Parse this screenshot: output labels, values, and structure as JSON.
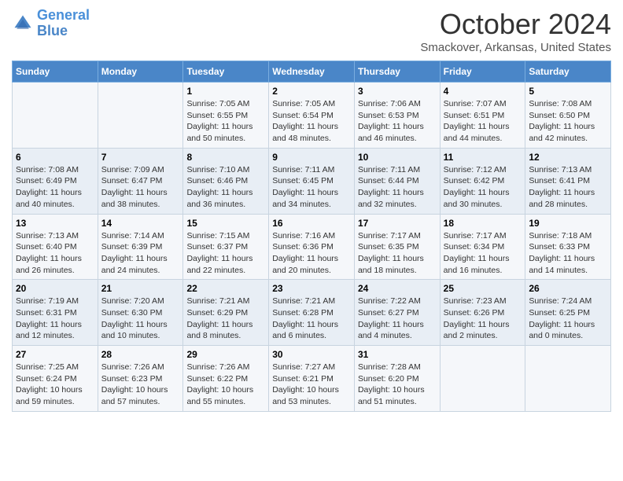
{
  "header": {
    "logo_line1": "General",
    "logo_line2": "Blue",
    "month": "October 2024",
    "location": "Smackover, Arkansas, United States"
  },
  "weekdays": [
    "Sunday",
    "Monday",
    "Tuesday",
    "Wednesday",
    "Thursday",
    "Friday",
    "Saturday"
  ],
  "weeks": [
    [
      {
        "day": "",
        "sunrise": "",
        "sunset": "",
        "daylight": ""
      },
      {
        "day": "",
        "sunrise": "",
        "sunset": "",
        "daylight": ""
      },
      {
        "day": "1",
        "sunrise": "Sunrise: 7:05 AM",
        "sunset": "Sunset: 6:55 PM",
        "daylight": "Daylight: 11 hours and 50 minutes."
      },
      {
        "day": "2",
        "sunrise": "Sunrise: 7:05 AM",
        "sunset": "Sunset: 6:54 PM",
        "daylight": "Daylight: 11 hours and 48 minutes."
      },
      {
        "day": "3",
        "sunrise": "Sunrise: 7:06 AM",
        "sunset": "Sunset: 6:53 PM",
        "daylight": "Daylight: 11 hours and 46 minutes."
      },
      {
        "day": "4",
        "sunrise": "Sunrise: 7:07 AM",
        "sunset": "Sunset: 6:51 PM",
        "daylight": "Daylight: 11 hours and 44 minutes."
      },
      {
        "day": "5",
        "sunrise": "Sunrise: 7:08 AM",
        "sunset": "Sunset: 6:50 PM",
        "daylight": "Daylight: 11 hours and 42 minutes."
      }
    ],
    [
      {
        "day": "6",
        "sunrise": "Sunrise: 7:08 AM",
        "sunset": "Sunset: 6:49 PM",
        "daylight": "Daylight: 11 hours and 40 minutes."
      },
      {
        "day": "7",
        "sunrise": "Sunrise: 7:09 AM",
        "sunset": "Sunset: 6:47 PM",
        "daylight": "Daylight: 11 hours and 38 minutes."
      },
      {
        "day": "8",
        "sunrise": "Sunrise: 7:10 AM",
        "sunset": "Sunset: 6:46 PM",
        "daylight": "Daylight: 11 hours and 36 minutes."
      },
      {
        "day": "9",
        "sunrise": "Sunrise: 7:11 AM",
        "sunset": "Sunset: 6:45 PM",
        "daylight": "Daylight: 11 hours and 34 minutes."
      },
      {
        "day": "10",
        "sunrise": "Sunrise: 7:11 AM",
        "sunset": "Sunset: 6:44 PM",
        "daylight": "Daylight: 11 hours and 32 minutes."
      },
      {
        "day": "11",
        "sunrise": "Sunrise: 7:12 AM",
        "sunset": "Sunset: 6:42 PM",
        "daylight": "Daylight: 11 hours and 30 minutes."
      },
      {
        "day": "12",
        "sunrise": "Sunrise: 7:13 AM",
        "sunset": "Sunset: 6:41 PM",
        "daylight": "Daylight: 11 hours and 28 minutes."
      }
    ],
    [
      {
        "day": "13",
        "sunrise": "Sunrise: 7:13 AM",
        "sunset": "Sunset: 6:40 PM",
        "daylight": "Daylight: 11 hours and 26 minutes."
      },
      {
        "day": "14",
        "sunrise": "Sunrise: 7:14 AM",
        "sunset": "Sunset: 6:39 PM",
        "daylight": "Daylight: 11 hours and 24 minutes."
      },
      {
        "day": "15",
        "sunrise": "Sunrise: 7:15 AM",
        "sunset": "Sunset: 6:37 PM",
        "daylight": "Daylight: 11 hours and 22 minutes."
      },
      {
        "day": "16",
        "sunrise": "Sunrise: 7:16 AM",
        "sunset": "Sunset: 6:36 PM",
        "daylight": "Daylight: 11 hours and 20 minutes."
      },
      {
        "day": "17",
        "sunrise": "Sunrise: 7:17 AM",
        "sunset": "Sunset: 6:35 PM",
        "daylight": "Daylight: 11 hours and 18 minutes."
      },
      {
        "day": "18",
        "sunrise": "Sunrise: 7:17 AM",
        "sunset": "Sunset: 6:34 PM",
        "daylight": "Daylight: 11 hours and 16 minutes."
      },
      {
        "day": "19",
        "sunrise": "Sunrise: 7:18 AM",
        "sunset": "Sunset: 6:33 PM",
        "daylight": "Daylight: 11 hours and 14 minutes."
      }
    ],
    [
      {
        "day": "20",
        "sunrise": "Sunrise: 7:19 AM",
        "sunset": "Sunset: 6:31 PM",
        "daylight": "Daylight: 11 hours and 12 minutes."
      },
      {
        "day": "21",
        "sunrise": "Sunrise: 7:20 AM",
        "sunset": "Sunset: 6:30 PM",
        "daylight": "Daylight: 11 hours and 10 minutes."
      },
      {
        "day": "22",
        "sunrise": "Sunrise: 7:21 AM",
        "sunset": "Sunset: 6:29 PM",
        "daylight": "Daylight: 11 hours and 8 minutes."
      },
      {
        "day": "23",
        "sunrise": "Sunrise: 7:21 AM",
        "sunset": "Sunset: 6:28 PM",
        "daylight": "Daylight: 11 hours and 6 minutes."
      },
      {
        "day": "24",
        "sunrise": "Sunrise: 7:22 AM",
        "sunset": "Sunset: 6:27 PM",
        "daylight": "Daylight: 11 hours and 4 minutes."
      },
      {
        "day": "25",
        "sunrise": "Sunrise: 7:23 AM",
        "sunset": "Sunset: 6:26 PM",
        "daylight": "Daylight: 11 hours and 2 minutes."
      },
      {
        "day": "26",
        "sunrise": "Sunrise: 7:24 AM",
        "sunset": "Sunset: 6:25 PM",
        "daylight": "Daylight: 11 hours and 0 minutes."
      }
    ],
    [
      {
        "day": "27",
        "sunrise": "Sunrise: 7:25 AM",
        "sunset": "Sunset: 6:24 PM",
        "daylight": "Daylight: 10 hours and 59 minutes."
      },
      {
        "day": "28",
        "sunrise": "Sunrise: 7:26 AM",
        "sunset": "Sunset: 6:23 PM",
        "daylight": "Daylight: 10 hours and 57 minutes."
      },
      {
        "day": "29",
        "sunrise": "Sunrise: 7:26 AM",
        "sunset": "Sunset: 6:22 PM",
        "daylight": "Daylight: 10 hours and 55 minutes."
      },
      {
        "day": "30",
        "sunrise": "Sunrise: 7:27 AM",
        "sunset": "Sunset: 6:21 PM",
        "daylight": "Daylight: 10 hours and 53 minutes."
      },
      {
        "day": "31",
        "sunrise": "Sunrise: 7:28 AM",
        "sunset": "Sunset: 6:20 PM",
        "daylight": "Daylight: 10 hours and 51 minutes."
      },
      {
        "day": "",
        "sunrise": "",
        "sunset": "",
        "daylight": ""
      },
      {
        "day": "",
        "sunrise": "",
        "sunset": "",
        "daylight": ""
      }
    ]
  ]
}
